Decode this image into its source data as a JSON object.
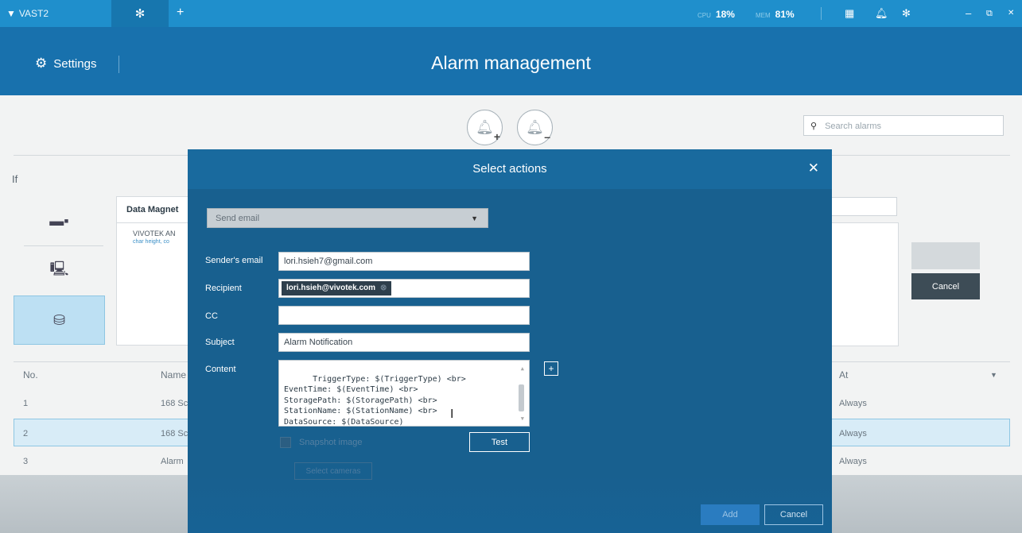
{
  "topbar": {
    "logo_mark": "▼",
    "app_name": "VAST2",
    "tab_icon": "gear-icon",
    "add_tab": "+",
    "cpu_label": "CPU",
    "cpu_value": "18%",
    "mem_label": "MEM",
    "mem_value": "81%",
    "icons": [
      "grid-icon",
      "bell-icon",
      "gear-icon",
      "minimize-icon",
      "restore-icon",
      "close-icon"
    ]
  },
  "header": {
    "settings_label": "Settings",
    "title": "Alarm management"
  },
  "toolbar": {
    "add_alarm_icon": "bell-plus-icon",
    "remove_alarm_icon": "bell-minus-icon",
    "search_placeholder": "Search alarms"
  },
  "condition": {
    "if_label": "If",
    "panel_title": "Data Magnet",
    "item_title": "VIVOTEK AN",
    "item_sub": "char height, co"
  },
  "right_panel": {
    "cancel_label": "Cancel"
  },
  "table": {
    "headers": {
      "no": "No.",
      "name": "Name",
      "at": "At"
    },
    "rows": [
      {
        "no": "1",
        "name": "168 Sc",
        "at": "Always"
      },
      {
        "no": "2",
        "name": "168 Sc",
        "at": "Always"
      },
      {
        "no": "3",
        "name": "Alarm",
        "at": "Always"
      }
    ]
  },
  "modal": {
    "title": "Select actions",
    "action_select": "Send email",
    "labels": {
      "sender": "Sender's email",
      "recipient": "Recipient",
      "cc": "CC",
      "subject": "Subject",
      "content": "Content"
    },
    "values": {
      "sender": "lori.hsieh7@gmail.com",
      "recipient_chip": "lori.hsieh@vivotek.com",
      "cc": "",
      "subject": "Alarm Notification",
      "content": "TriggerType: $(TriggerType) <br>\nEventTime: $(EventTime) <br>\nStoragePath: $(StoragePath) <br>\nStationName: $(StationName) <br>\nDataSource: $(DataSource)"
    },
    "snapshot_label": "Snapshot image",
    "test_label": "Test",
    "select_cameras_label": "Select cameras",
    "add_label": "Add",
    "cancel_label": "Cancel"
  },
  "colors": {
    "topbar": "#1f8fcc",
    "header": "#1871ad",
    "modal": "#196a9e",
    "selection": "#d8ecf7"
  }
}
